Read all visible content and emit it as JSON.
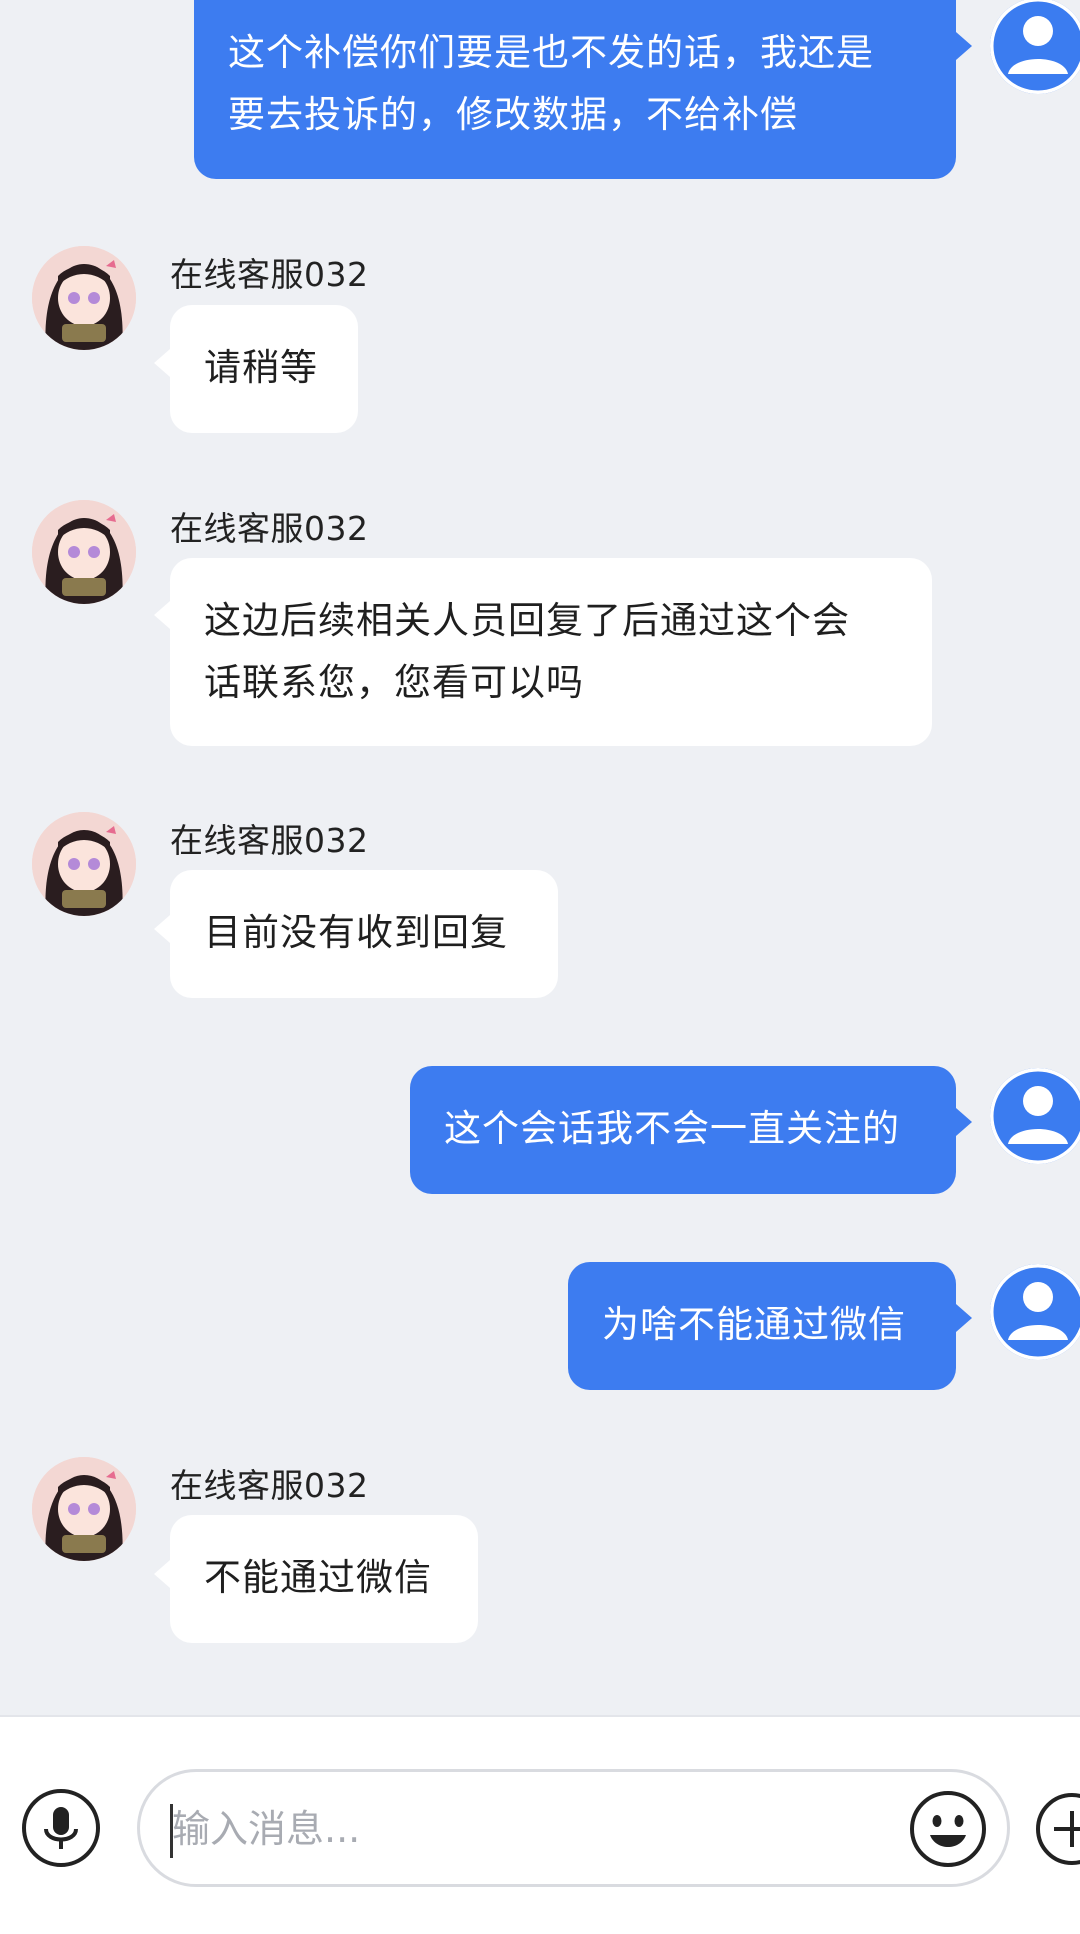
{
  "messages": [
    {
      "sender": "me",
      "lines": [
        "这个补偿你们要是也不发的话，我还是",
        "要去投诉的，修改数据，不给补偿"
      ]
    },
    {
      "sender": "agent",
      "name": "在线客服032",
      "lines": [
        "请稍等"
      ]
    },
    {
      "sender": "agent",
      "name": "在线客服032",
      "lines": [
        "这边后续相关人员回复了后通过这个会",
        "话联系您，您看可以吗"
      ]
    },
    {
      "sender": "agent",
      "name": "在线客服032",
      "lines": [
        "目前没有收到回复"
      ]
    },
    {
      "sender": "me",
      "lines": [
        "这个会话我不会一直关注的"
      ]
    },
    {
      "sender": "me",
      "lines": [
        "为啥不能通过微信"
      ]
    },
    {
      "sender": "agent",
      "name": "在线客服032",
      "lines": [
        "不能通过微信"
      ]
    }
  ],
  "composer": {
    "placeholder": "输入消息..."
  },
  "icons": {
    "voice": "microphone-icon",
    "emoji": "emoji-icon",
    "more": "plus-icon",
    "user_avatar": "user-avatar-icon"
  },
  "colors": {
    "outgoing_bubble": "#3d7cf0",
    "incoming_bubble": "#ffffff",
    "background": "#eef0f4"
  }
}
